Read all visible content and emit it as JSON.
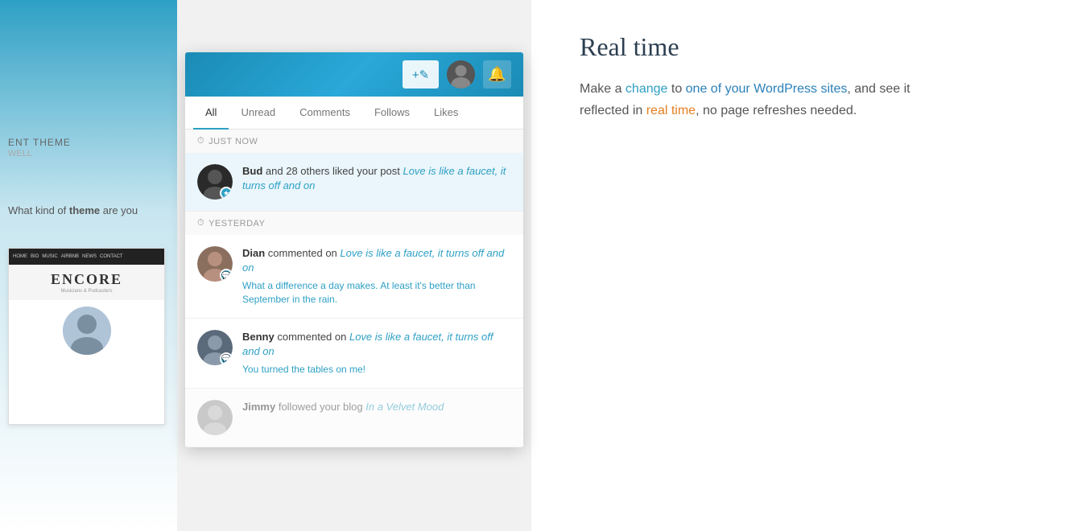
{
  "background": {
    "left_panel": {
      "theme_label": "ENT THEME",
      "theme_subtitle": "WELL",
      "question_text_1": "What kind of",
      "question_bold": "theme",
      "question_text_2": "are you",
      "encore_title": "ENCORE",
      "encore_subtitle": "Musicians & Podcasters"
    }
  },
  "right_content": {
    "heading": "Real time",
    "paragraph_parts": [
      {
        "text": "Make a ",
        "type": "normal"
      },
      {
        "text": "change",
        "type": "teal"
      },
      {
        "text": " to ",
        "type": "normal"
      },
      {
        "text": "one of your WordPress sites",
        "type": "blue"
      },
      {
        "text": ", and see",
        "type": "normal"
      },
      {
        "text": "\nit reflected in ",
        "type": "normal"
      },
      {
        "text": "real time",
        "type": "orange"
      },
      {
        "text": ", no page refreshes needed.",
        "type": "normal"
      }
    ]
  },
  "notification_panel": {
    "header": {
      "compose_label": "✎+",
      "bell_label": "🔔"
    },
    "tabs": [
      {
        "id": "all",
        "label": "All",
        "active": true
      },
      {
        "id": "unread",
        "label": "Unread",
        "active": false
      },
      {
        "id": "comments",
        "label": "Comments",
        "active": false
      },
      {
        "id": "follows",
        "label": "Follows",
        "active": false
      },
      {
        "id": "likes",
        "label": "Likes",
        "active": false
      }
    ],
    "sections": [
      {
        "label": "JUST NOW",
        "items": [
          {
            "id": "bud",
            "avatar_class": "avatar-bud",
            "badge_type": "star",
            "user": "Bud",
            "action": "and 28 others liked your post",
            "post_title": "Love is like a faucet, it turns off and on",
            "highlighted": true
          }
        ]
      },
      {
        "label": "YESTERDAY",
        "items": [
          {
            "id": "dian",
            "avatar_class": "avatar-dian",
            "badge_type": "comment",
            "user": "Dian",
            "action": "commented on",
            "post_title": "Love is like a faucet, it turns off and on",
            "excerpt": "What a difference a day makes. At least it's better than September in the rain.",
            "highlighted": false
          },
          {
            "id": "benny",
            "avatar_class": "avatar-benny",
            "badge_type": "comment",
            "user": "Benny",
            "action": "commented on",
            "post_title": "Love is like a faucet, it turns off and on",
            "excerpt": "You turned the tables on me!",
            "highlighted": false
          },
          {
            "id": "jimmy",
            "avatar_class": "avatar-jimmy",
            "badge_type": "follow",
            "user": "Jimmy",
            "action": "followed your blog",
            "post_title": "In a Velvet Mood",
            "faded": true,
            "highlighted": false
          }
        ]
      }
    ]
  }
}
